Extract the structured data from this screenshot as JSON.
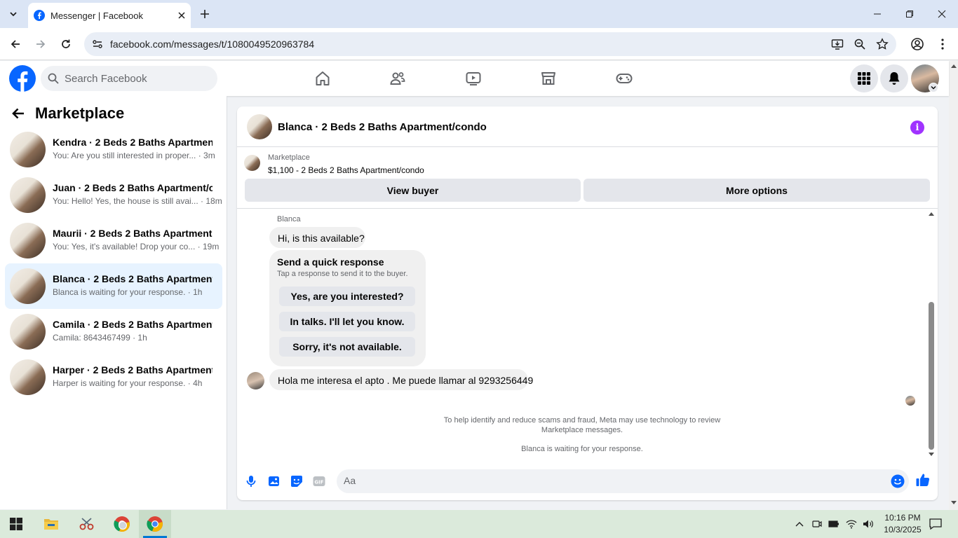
{
  "browser": {
    "tab_title": "Messenger | Facebook",
    "url": "facebook.com/messages/t/1080049520963784"
  },
  "fb_header": {
    "search_placeholder": "Search Facebook"
  },
  "sidebar": {
    "title": "Marketplace",
    "conversations": [
      {
        "name": "Kendra · 2 Beds 2 Baths Apartmen...",
        "preview": "You: Are you still interested in proper...",
        "time": "· 3m",
        "active": false
      },
      {
        "name": "Juan · 2 Beds 2 Baths Apartment/c...",
        "preview": "You: Hello! Yes, the house is still avai...",
        "time": "· 18m",
        "active": false
      },
      {
        "name": "Maurii · 2 Beds 2 Baths Apartment...",
        "preview": "You: Yes, it's available! Drop your co...",
        "time": "· 19m",
        "active": false
      },
      {
        "name": "Blanca · 2 Beds 2 Baths Apartment...",
        "preview": "Blanca is waiting for your response.",
        "time": "· 1h",
        "active": true
      },
      {
        "name": "Camila · 2 Beds 2 Baths Apartment...",
        "preview": "Camila: 8643467499",
        "time": "· 1h",
        "active": false
      },
      {
        "name": "Harper · 2 Beds 2 Baths Apartment...",
        "preview": "Harper is waiting for your response.",
        "time": "· 4h",
        "active": false
      }
    ]
  },
  "chat": {
    "title": "Blanca · 2 Beds 2 Baths Apartment/condo",
    "listing_source": "Marketplace",
    "listing_title": "$1,100 - 2 Beds 2 Baths Apartment/condo",
    "view_buyer": "View buyer",
    "more_options": "More options",
    "sender_label": "Blanca",
    "message_1": "Hi, is this available?",
    "quick_title": "Send a quick response",
    "quick_sub": "Tap a response to send it to the buyer.",
    "quick_replies": [
      "Yes, are you interested?",
      "In talks. I'll let you know.",
      "Sorry, it's not available."
    ],
    "message_2": "Hola me interesa el apto . Me puede llamar al 9293256449",
    "notice_1": "To help identify and reduce scams and fraud, Meta may use technology to review",
    "notice_2": "Marketplace messages.",
    "waiting": "Blanca is waiting for your response.",
    "composer_placeholder": "Aa"
  },
  "taskbar": {
    "time": "10:16 PM",
    "date": "10/3/2025"
  },
  "colors": {
    "facebook_blue": "#0866ff",
    "info_purple": "#a033ff",
    "active_row": "#e7f3ff"
  }
}
